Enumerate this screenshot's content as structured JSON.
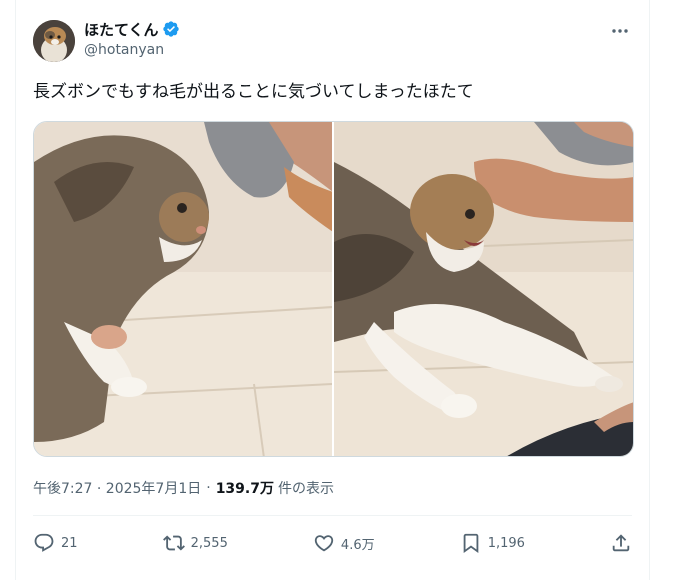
{
  "author": {
    "display_name": "ほたてくん",
    "handle": "@hotanyan",
    "verified": true
  },
  "tweet": {
    "text": "長ズボンでもすね毛が出ることに気づいてしまったほたて"
  },
  "meta": {
    "timestamp": "午後7:27 · 2025年7月1日",
    "separator": "·",
    "views_count": "139.7万",
    "views_label": "件の表示"
  },
  "actions": {
    "replies": "21",
    "reposts": "2,555",
    "likes": "4.6万",
    "bookmarks": "1,196"
  },
  "icons": {
    "verified": "verified-badge-icon",
    "more": "more-icon",
    "reply": "reply-icon",
    "repost": "repost-icon",
    "like": "heart-icon",
    "bookmark": "bookmark-icon",
    "share": "share-icon"
  },
  "colors": {
    "text_primary": "#0f1419",
    "text_secondary": "#536471",
    "verified_blue": "#1d9bf0",
    "border": "#cfd9de"
  }
}
